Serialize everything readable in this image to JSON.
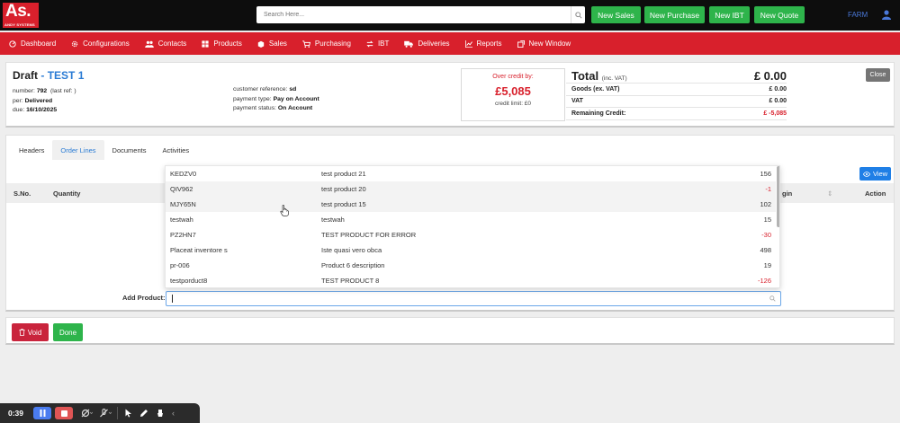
{
  "logo": {
    "text": "As.",
    "subtext": "ANDY SYSTEMS"
  },
  "search": {
    "placeholder": "Search Here..."
  },
  "header_buttons": [
    "New Sales",
    "New Purchase",
    "New IBT",
    "New Quote"
  ],
  "user": {
    "name": "FARM"
  },
  "nav": [
    {
      "label": "Dashboard",
      "icon": "dashboard-icon"
    },
    {
      "label": "Configurations",
      "icon": "gear-icon"
    },
    {
      "label": "Contacts",
      "icon": "contacts-icon"
    },
    {
      "label": "Products",
      "icon": "products-icon"
    },
    {
      "label": "Sales",
      "icon": "sales-icon"
    },
    {
      "label": "Purchasing",
      "icon": "cart-icon"
    },
    {
      "label": "IBT",
      "icon": "transfer-icon"
    },
    {
      "label": "Deliveries",
      "icon": "truck-icon"
    },
    {
      "label": "Reports",
      "icon": "chart-icon"
    },
    {
      "label": "New Window",
      "icon": "window-icon"
    }
  ],
  "order": {
    "status": "Draft",
    "separator": " - ",
    "name": "TEST 1",
    "number_label": "number:",
    "number": "792",
    "last_ref": "(last ref: )",
    "per_label": "per:",
    "per": "Delivered",
    "due_label": "due:",
    "due": "16/10/2025",
    "customer_ref_label": "customer reference:",
    "customer_ref": "sd",
    "payment_type_label": "payment type:",
    "payment_type": "Pay on Account",
    "payment_status_label": "payment status:",
    "payment_status": "On Account"
  },
  "credit": {
    "label": "Over credit by:",
    "value": "£5,085",
    "limit": "credit limit: £0"
  },
  "totals": {
    "total_label": "Total",
    "total_suffix": "(inc. VAT)",
    "total_value": "£ 0.00",
    "goods_label": "Goods (ex. VAT)",
    "goods_value": "£ 0.00",
    "vat_label": "VAT",
    "vat_value": "£ 0.00",
    "remaining_label": "Remaining Credit:",
    "remaining_value": "£ -5,085"
  },
  "close_label": "Close",
  "tabs": [
    "Headers",
    "Order Lines",
    "Documents",
    "Activities"
  ],
  "active_tab": "Order Lines",
  "view_label": "View",
  "table_headers": {
    "sno": "S.No.",
    "quantity": "Quantity",
    "margin": "gin",
    "action": "Action"
  },
  "add_product_label": "Add Product:",
  "dropdown": [
    {
      "code": "KEDZV0",
      "desc": "test product 21",
      "qty": "156"
    },
    {
      "code": "QIV962",
      "desc": "test product 20",
      "qty": "-1"
    },
    {
      "code": "MJY65N",
      "desc": "test product 15",
      "qty": "102"
    },
    {
      "code": "testwah",
      "desc": "testwah",
      "qty": "15"
    },
    {
      "code": "PZ2HN7",
      "desc": "TEST PRODUCT FOR ERROR",
      "qty": "-30"
    },
    {
      "code": "Placeat inventore s",
      "desc": "Iste quasi vero obca",
      "qty": "498"
    },
    {
      "code": "pr-006",
      "desc": "Product 6 description",
      "qty": "19"
    },
    {
      "code": "testporduct8",
      "desc": "TEST PRODUCT 8",
      "qty": "-126"
    }
  ],
  "void_label": "Void",
  "done_label": "Done",
  "recorder": {
    "time": "0:39"
  },
  "colors": {
    "brand_red": "#d8202c",
    "green": "#2eb44b",
    "blue": "#1f7fe6",
    "link_blue": "#2a7bd4"
  }
}
